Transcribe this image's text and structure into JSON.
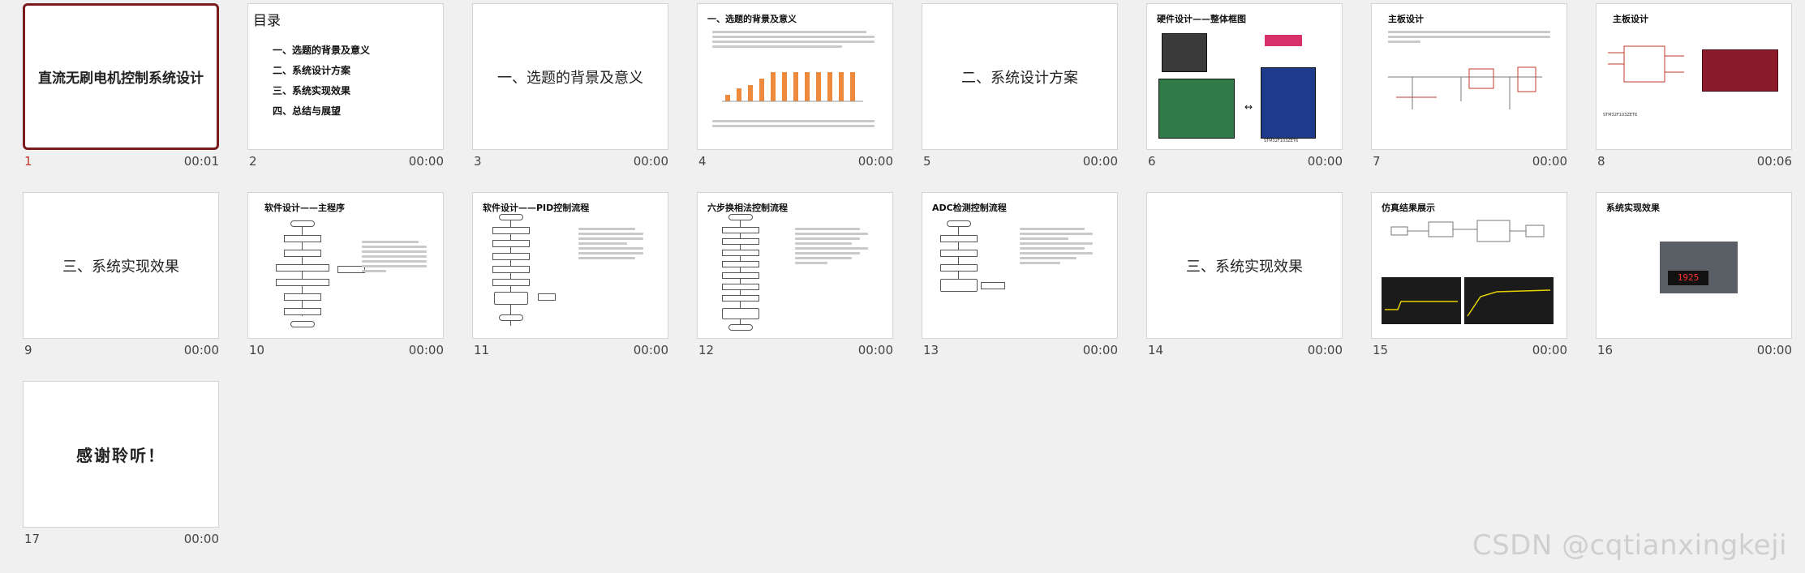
{
  "slides": [
    {
      "num": "1",
      "time": "00:01",
      "selected": true,
      "title": "直流无刷电机控制系统设计"
    },
    {
      "num": "2",
      "time": "00:00",
      "title": "目录",
      "items": [
        "一、选题的背景及意义",
        "二、系统设计方案",
        "三、系统实现效果",
        "四、总结与展望"
      ]
    },
    {
      "num": "3",
      "time": "00:00",
      "title": "一、选题的背景及意义"
    },
    {
      "num": "4",
      "time": "00:00",
      "title": "一、选题的背景及意义"
    },
    {
      "num": "5",
      "time": "00:00",
      "title": "二、系统设计方案"
    },
    {
      "num": "6",
      "time": "00:00",
      "title": "硬件设计——整体框图",
      "labels": [
        "STM32F103ZET6"
      ]
    },
    {
      "num": "7",
      "time": "00:00",
      "title": "主板设计"
    },
    {
      "num": "8",
      "time": "00:06",
      "title": "主板设计",
      "labels": [
        "STM32F103ZET6"
      ]
    },
    {
      "num": "9",
      "time": "00:00",
      "title": "三、系统实现效果"
    },
    {
      "num": "10",
      "time": "00:00",
      "title": "软件设计——主程序"
    },
    {
      "num": "11",
      "time": "00:00",
      "title": "软件设计——PID控制流程"
    },
    {
      "num": "12",
      "time": "00:00",
      "title": "六步换相法控制流程"
    },
    {
      "num": "13",
      "time": "00:00",
      "title": "ADC检测控制流程"
    },
    {
      "num": "14",
      "time": "00:00",
      "title": "三、系统实现效果"
    },
    {
      "num": "15",
      "time": "00:00",
      "title": "仿真结果展示"
    },
    {
      "num": "16",
      "time": "00:00",
      "title": "系统实现效果",
      "display": "1925"
    },
    {
      "num": "17",
      "time": "00:00",
      "title": "感谢聆听！"
    }
  ],
  "watermark": "CSDN @cqtianxingkeji",
  "colors": {
    "selected_border": "#7a1c1c",
    "selected_number": "#c0392b",
    "chart_bar": "#ef8a3c",
    "lcd": "#ff3030"
  }
}
